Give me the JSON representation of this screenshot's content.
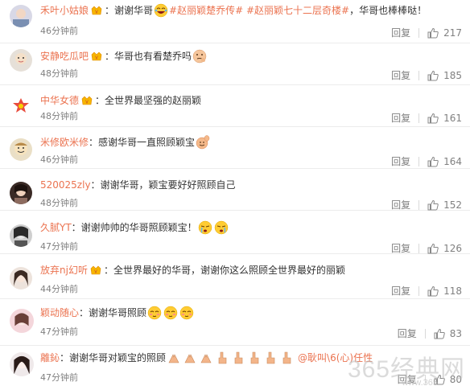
{
  "colors": {
    "username": "#eb7350",
    "hashtag": "#eb7350",
    "time": "#808080",
    "action": "#808080"
  },
  "comments": [
    {
      "username": "禾叶小姑娘",
      "vip": true,
      "text_a": "：谢谢华哥",
      "emoji_a": "laugh-cry-emoji",
      "hashtags": "#赵丽颖楚乔传# #赵丽颖七十二层奇楼#",
      "text_b": "，华哥也棒棒哒！",
      "time": "46分钟前",
      "reply": "回复",
      "likes": "217"
    },
    {
      "username": "安静吃瓜吧",
      "vip": true,
      "text_a": "：华哥也有看楚乔吗",
      "emoji_a": "thinking-emoji",
      "time": "48分钟前",
      "reply": "回复",
      "likes": "185"
    },
    {
      "username": "中华女德",
      "vip": true,
      "text_a": "：全世界最坚强的赵丽颖",
      "time": "48分钟前",
      "reply": "回复",
      "likes": "161"
    },
    {
      "username": "米修欧米修",
      "vip": false,
      "text_a": "：感谢华哥一直照顾颖宝",
      "emoji_a": "wave-emoji",
      "time": "46分钟前",
      "reply": "回复",
      "likes": "164"
    },
    {
      "username": "520025zly",
      "vip": false,
      "text_a": "：谢谢华哥，颖宝要好好照顾自己",
      "time": "48分钟前",
      "reply": "回复",
      "likes": "152"
    },
    {
      "username": "久腻YT",
      "vip": false,
      "text_a": "：谢谢帅帅的华哥照顾颖宝！",
      "emoji_a": "tearful-emoji",
      "time": "47分钟前",
      "reply": "回复",
      "likes": "126"
    },
    {
      "username": "放弃nj幻听",
      "vip": true,
      "text_a": "：全世界最好的华哥，谢谢你这么照顾全世界最好的丽颖",
      "time": "44分钟前",
      "reply": "回复",
      "likes": "118"
    },
    {
      "username": "颖动随心",
      "vip": false,
      "text_a": "：谢谢华哥照顾",
      "emoji_a": "blushing-emoji",
      "time": "47分钟前",
      "reply": "回复",
      "likes": "83"
    },
    {
      "username": "離鈊",
      "vip": false,
      "text_a": "：谢谢华哥对颖宝的照顾",
      "emoji_a": "praying-hands-emoji",
      "mention": "@耿叫\\6(心)任性",
      "time": "47分钟前",
      "reply": "回复",
      "likes": "80"
    }
  ],
  "watermark": {
    "text": "365经典网",
    "url": "www.365"
  }
}
